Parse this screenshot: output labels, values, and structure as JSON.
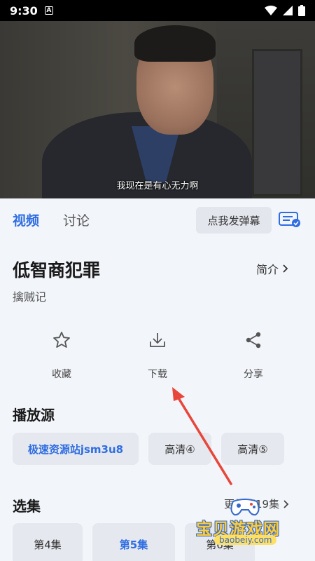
{
  "status_bar": {
    "time": "9:30",
    "badge": "A"
  },
  "player": {
    "subtitle": "我现在是有心无力啊"
  },
  "tabs": [
    {
      "label": "视频"
    },
    {
      "label": "讨论"
    }
  ],
  "danmu_button": "点我发弹幕",
  "show": {
    "title": "低智商犯罪",
    "intro_label": "简介",
    "subtitle": "擒贼记"
  },
  "actions": [
    {
      "label": "收藏",
      "icon": "star-icon"
    },
    {
      "label": "下载",
      "icon": "download-icon"
    },
    {
      "label": "分享",
      "icon": "share-icon"
    }
  ],
  "sources_section": {
    "title": "播放源",
    "items": [
      {
        "label": "极速资源站jsm3u8",
        "active": true
      },
      {
        "label": "高清④",
        "active": false
      },
      {
        "label": "高清⑤",
        "active": false
      }
    ]
  },
  "episodes_section": {
    "title": "选集",
    "more_label": "更新至19集",
    "items": [
      {
        "label": "第4集",
        "active": false
      },
      {
        "label": "第5集",
        "active": true
      },
      {
        "label": "第6集",
        "active": false
      }
    ]
  },
  "watermark": {
    "text": "宝贝游戏网",
    "url": "baobeiy.com"
  },
  "colors": {
    "accent": "#2f6de1",
    "arrow": "#e8463a",
    "background": "#f2f5fa"
  }
}
